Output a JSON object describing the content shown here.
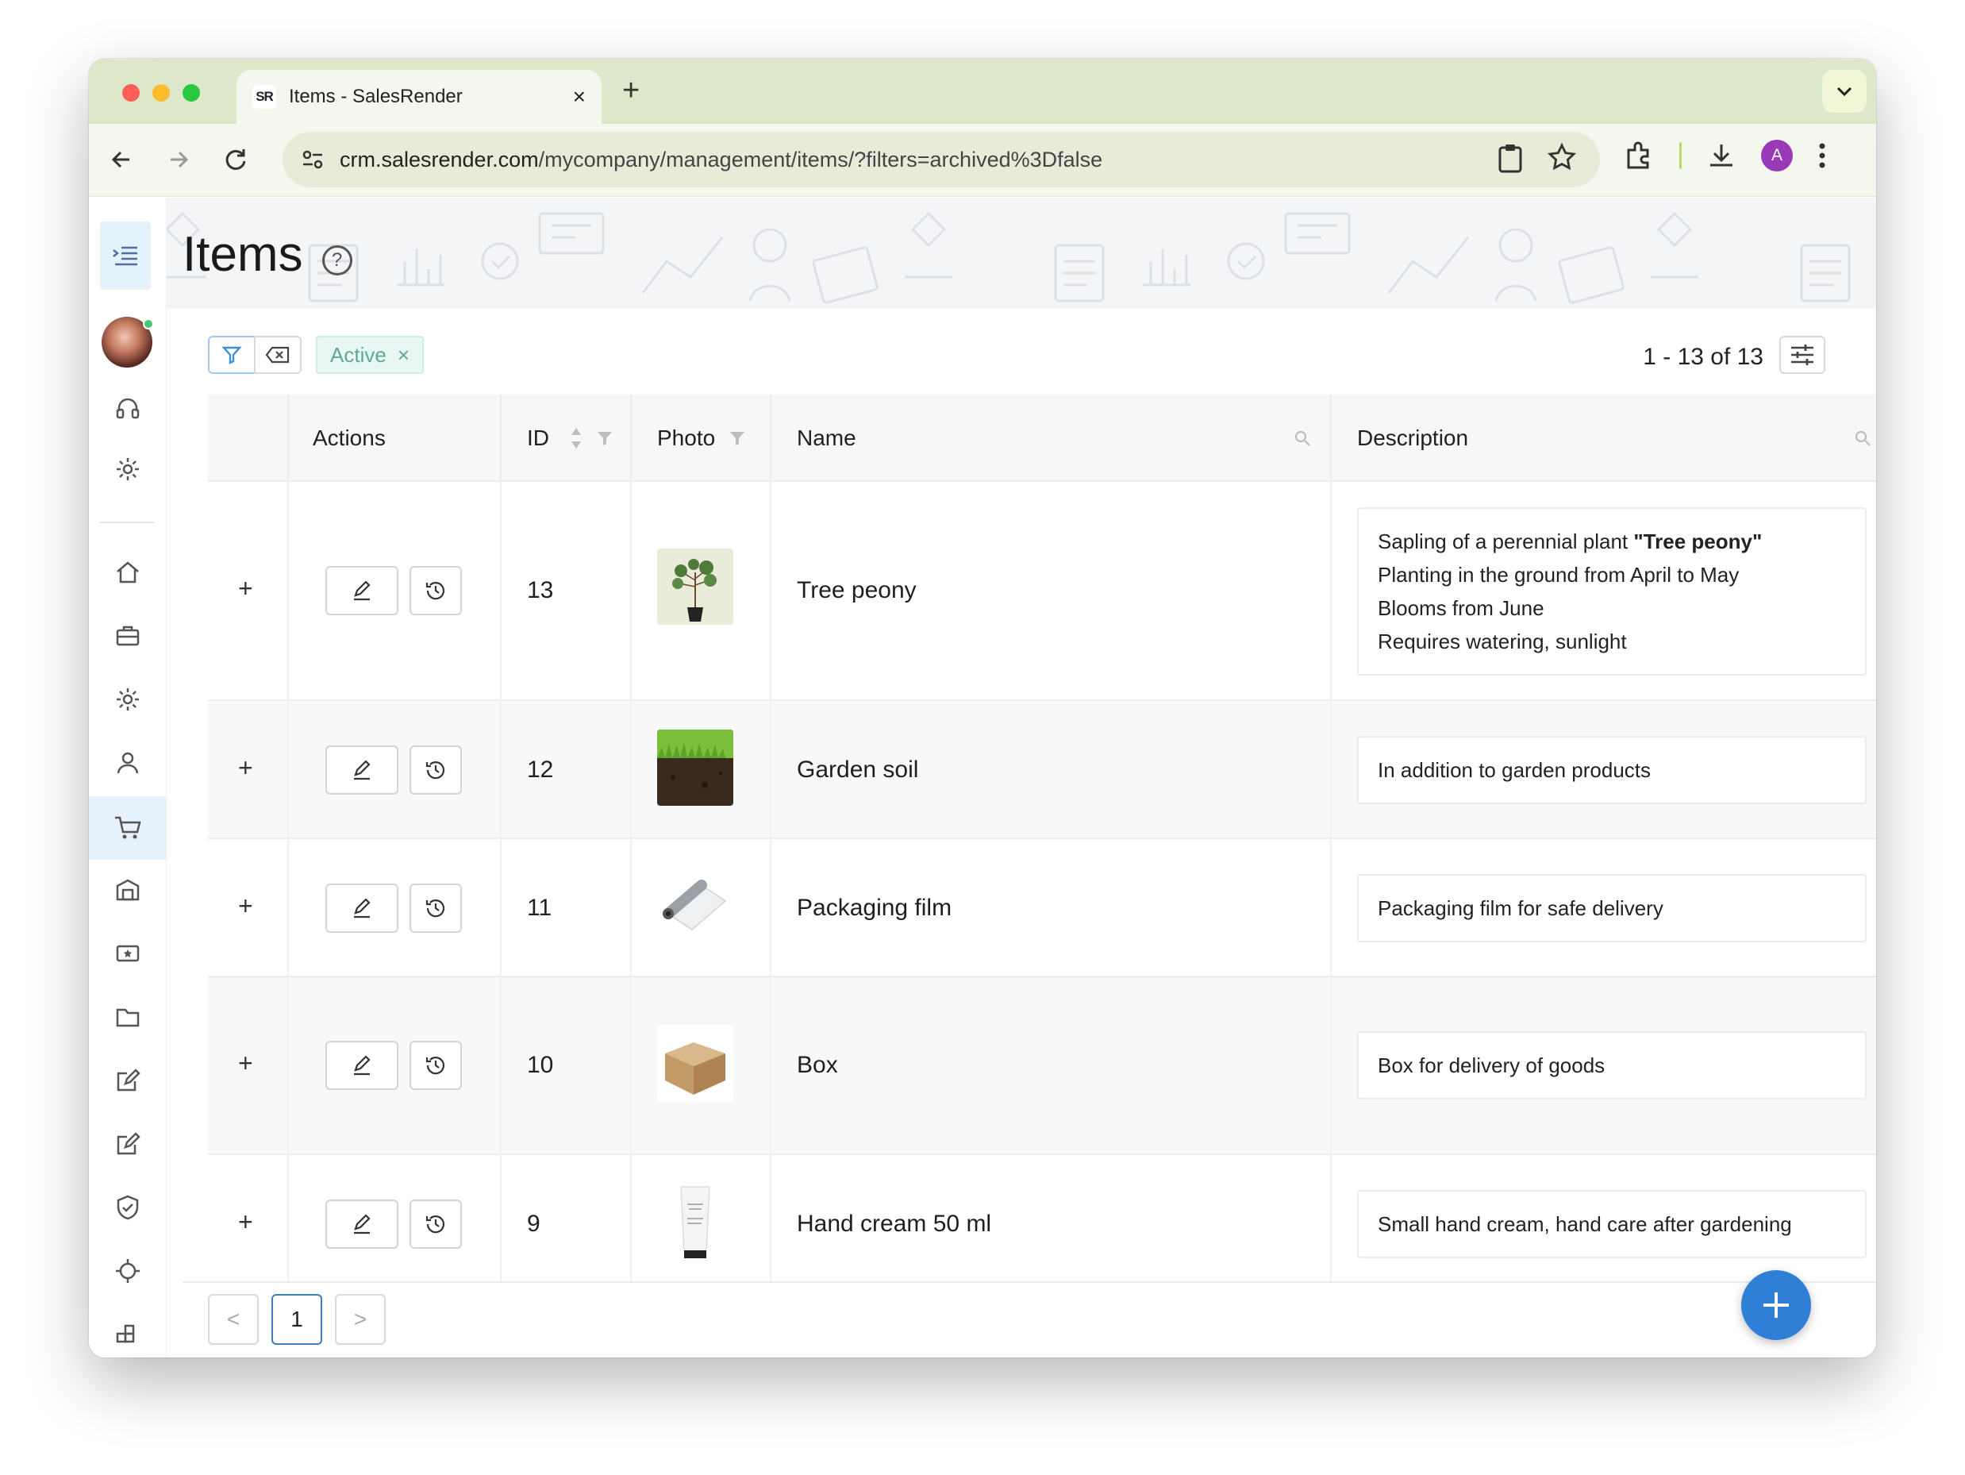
{
  "browser": {
    "tab_title": "Items - SalesRender",
    "favicon_text": "SR",
    "url_host": "crm.salesrender.com",
    "url_path": "/mycompany/management/items/?filters=archived%3Dfalse",
    "profile_initial": "A"
  },
  "page": {
    "title": "Items",
    "help_glyph": "?"
  },
  "filters": {
    "active_chip": "Active",
    "chip_close": "×"
  },
  "pagination": {
    "count_text": "1 - 13 of 13",
    "current_page": "1",
    "prev_glyph": "<",
    "next_glyph": ">"
  },
  "table": {
    "columns": {
      "actions": "Actions",
      "id": "ID",
      "photo": "Photo",
      "name": "Name",
      "description": "Description"
    },
    "rows": [
      {
        "id": "13",
        "name": "Tree peony",
        "photo": "tree-peony-photo",
        "desc": [
          "Sapling of a perennial plant ",
          "\"Tree peony\"",
          "Planting in the ground from April to May",
          "Blooms from June",
          "Requires watering, sunlight"
        ]
      },
      {
        "id": "12",
        "name": "Garden soil",
        "photo": "garden-soil-photo",
        "desc": [
          "In addition to garden products"
        ]
      },
      {
        "id": "11",
        "name": "Packaging film",
        "photo": "packaging-film-photo",
        "desc": [
          "Packaging film for safe delivery"
        ]
      },
      {
        "id": "10",
        "name": "Box",
        "photo": "box-photo",
        "desc": [
          "Box for delivery of goods"
        ]
      },
      {
        "id": "9",
        "name": "Hand cream 50 ml",
        "photo": "hand-cream-photo",
        "desc": [
          "Small hand cream, hand care after gardening"
        ]
      }
    ]
  },
  "icons": {
    "expand": "+",
    "fab": "plus-icon"
  },
  "colors": {
    "accent": "#2f7fd6",
    "chip_bg": "#e8f7f3",
    "chip_text": "#5fa896",
    "tabstrip": "#dde7c9",
    "online": "#48c774"
  }
}
